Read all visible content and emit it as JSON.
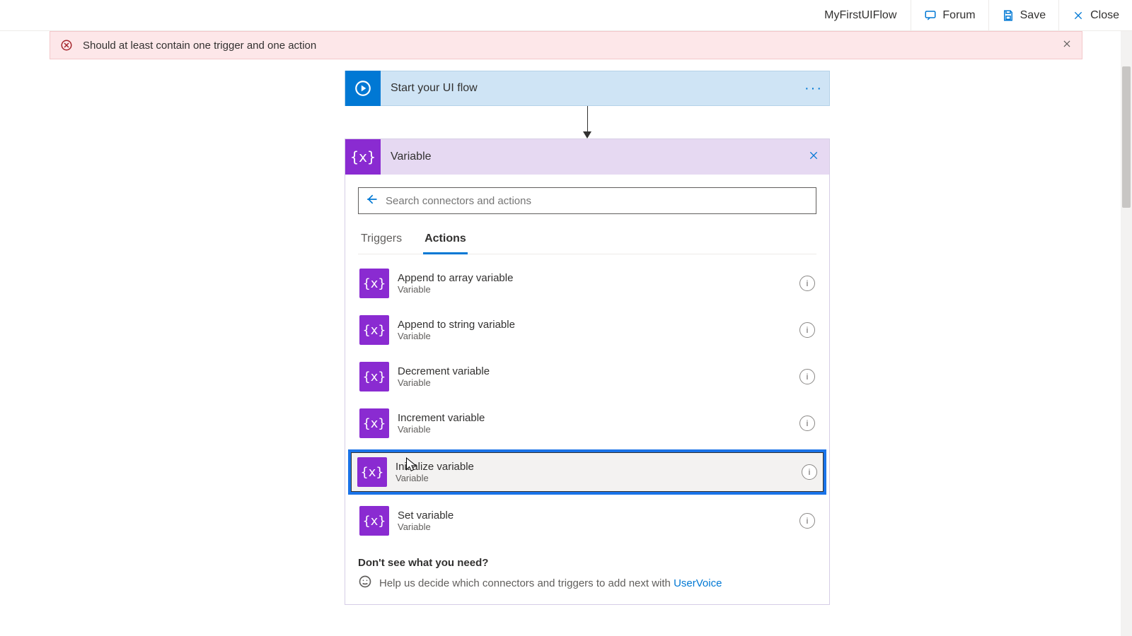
{
  "topbar": {
    "title": "MyFirstUIFlow",
    "forum": "Forum",
    "save": "Save",
    "close": "Close"
  },
  "banner": {
    "text": "Should at least contain one trigger and one action"
  },
  "flow": {
    "start_label": "Start your UI flow"
  },
  "picker": {
    "title": "Variable",
    "search_placeholder": "Search connectors and actions",
    "tabs": {
      "triggers": "Triggers",
      "actions": "Actions"
    },
    "actions": [
      {
        "name": "Append to array variable",
        "sub": "Variable"
      },
      {
        "name": "Append to string variable",
        "sub": "Variable"
      },
      {
        "name": "Decrement variable",
        "sub": "Variable"
      },
      {
        "name": "Increment variable",
        "sub": "Variable"
      },
      {
        "name": "Initialize variable",
        "sub": "Variable"
      },
      {
        "name": "Set variable",
        "sub": "Variable"
      }
    ],
    "footer_q": "Don't see what you need?",
    "footer_text": "Help us decide which connectors and triggers to add next with ",
    "footer_link": "UserVoice"
  }
}
